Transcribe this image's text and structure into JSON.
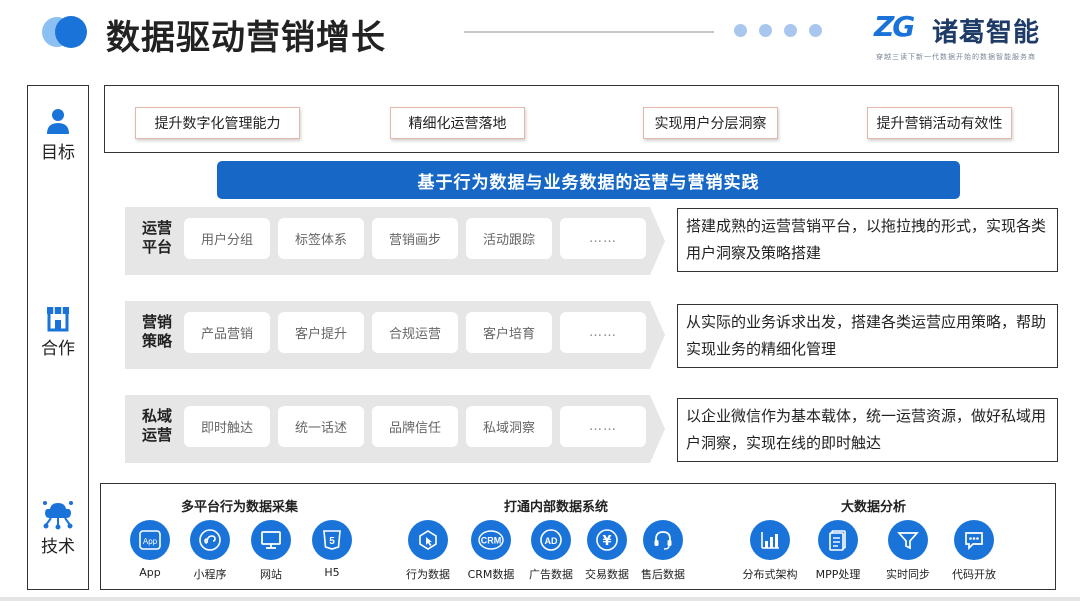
{
  "header": {
    "title": "数据驱动营销增长",
    "brand_mark": "ZG",
    "brand_name": "诸葛智能",
    "brand_slogan": "穿越三读下新一代数据开始的数据智能服务商",
    "colors": {
      "accent": "#1768c6",
      "icon_blue": "#1a73d9",
      "dot": "#a9c7ee"
    }
  },
  "left": {
    "goal": {
      "label": "目标",
      "icon": "person-icon"
    },
    "cooperation": {
      "label": "合作",
      "icon": "store-icon"
    },
    "tech": {
      "label": "技术",
      "icon": "network-icon"
    }
  },
  "goals": [
    "提升数字化管理能力",
    "精细化运营落地",
    "实现用户分层洞察",
    "提升营销活动有效性"
  ],
  "banner": "基于行为数据与业务数据的运营与营销实践",
  "rows": [
    {
      "label_1": "运营",
      "label_2": "平台",
      "items": [
        "用户分组",
        "标签体系",
        "营销画步",
        "活动跟踪",
        "……"
      ],
      "desc": "搭建成熟的运营营销平台，以拖拉拽的形式，实现各类用户洞察及策略搭建"
    },
    {
      "label_1": "营销",
      "label_2": "策略",
      "items": [
        "产品营销",
        "客户提升",
        "合规运营",
        "客户培育",
        "……"
      ],
      "desc": "从实际的业务诉求出发，搭建各类运营应用策略，帮助实现业务的精细化管理"
    },
    {
      "label_1": "私域",
      "label_2": "运营",
      "items": [
        "即时触达",
        "统一话述",
        "品牌信任",
        "私域洞察",
        "……"
      ],
      "desc": "以企业微信作为基本载体，统一运营资源，做好私域用户洞察，实现在线的即时触达"
    }
  ],
  "tech": {
    "groups": [
      {
        "title": "多平台行为数据采集",
        "items": [
          {
            "label": "App",
            "icon": "app-icon",
            "icon_text": "App"
          },
          {
            "label": "小程序",
            "icon": "mini-program-icon"
          },
          {
            "label": "网站",
            "icon": "monitor-icon"
          },
          {
            "label": "H5",
            "icon": "html5-icon",
            "icon_text": "5"
          }
        ]
      },
      {
        "title": "打通内部数据系统",
        "items": [
          {
            "label": "行为数据",
            "icon": "cursor-icon"
          },
          {
            "label": "CRM数据",
            "icon": "crm-icon",
            "icon_text": "CRM"
          },
          {
            "label": "广告数据",
            "icon": "ad-icon",
            "icon_text": "AD"
          },
          {
            "label": "交易数据",
            "icon": "yen-icon",
            "icon_text": "¥"
          },
          {
            "label": "售后数据",
            "icon": "headset-icon"
          }
        ]
      },
      {
        "title": "大数据分析",
        "items": [
          {
            "label": "分布式架构",
            "icon": "bar-chart-icon"
          },
          {
            "label": "MPP处理",
            "icon": "document-icon"
          },
          {
            "label": "实时同步",
            "icon": "funnel-icon"
          },
          {
            "label": "代码开放",
            "icon": "chat-icon"
          }
        ]
      }
    ]
  }
}
